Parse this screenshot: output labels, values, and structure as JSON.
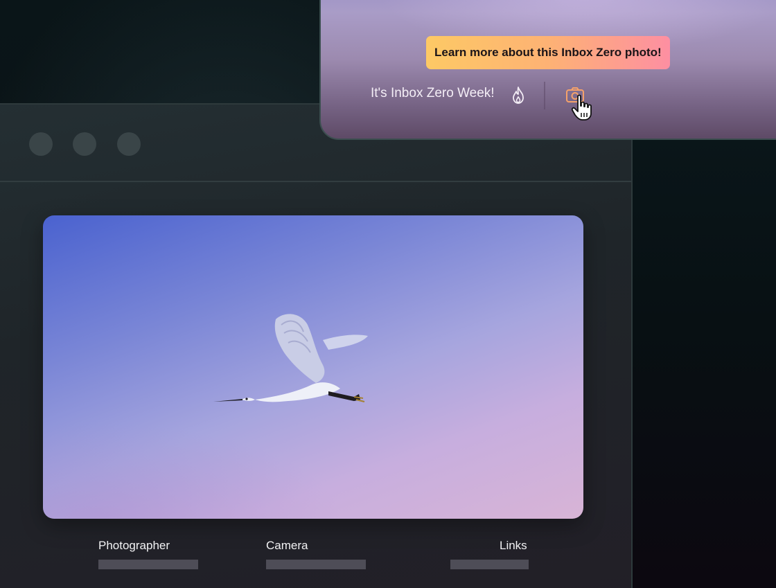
{
  "window": {
    "traffic_lights": [
      "window-dot-1",
      "window-dot-2",
      "window-dot-3"
    ]
  },
  "photo": {
    "subject_icon": "egret-in-flight"
  },
  "meta": {
    "photographer_label": "Photographer",
    "camera_label": "Camera",
    "links_label": "Links"
  },
  "panel": {
    "tooltip": "Learn more about this Inbox Zero photo!",
    "week_text": "It's Inbox Zero Week!",
    "flame_icon": "flame-icon",
    "camera_icon": "camera-icon",
    "cursor_icon": "hand-pointer-icon"
  },
  "colors": {
    "tooltip_gradient": [
      "#fdc965",
      "#fd8fa2"
    ],
    "camera_icon": "#f6a26a",
    "background": "#0a1518"
  }
}
